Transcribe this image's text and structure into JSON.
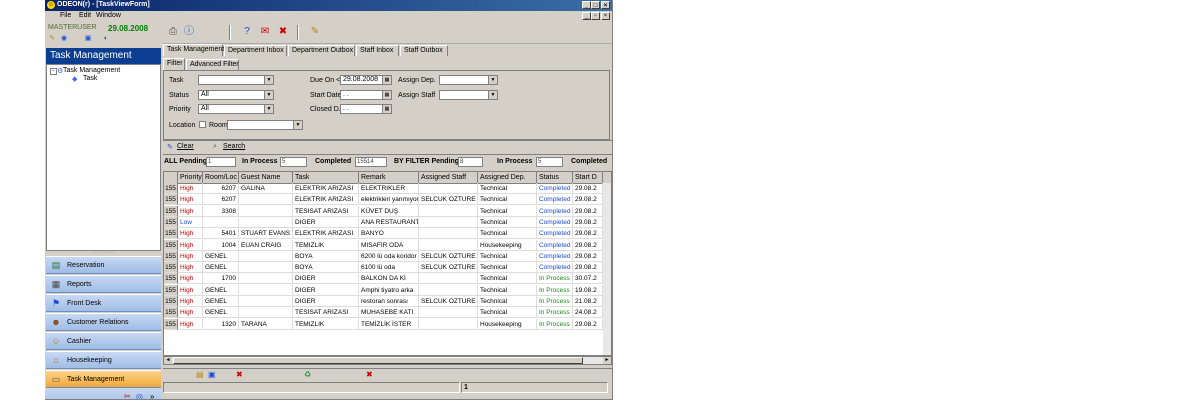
{
  "window": {
    "title": "ODEON(r) - [TaskViewForm]",
    "controls": [
      "_",
      "□",
      "×"
    ],
    "mdi_controls": [
      "_",
      "▫",
      "×"
    ]
  },
  "menu": [
    "File",
    "Edit",
    "Window"
  ],
  "user": {
    "name": "MASTERUSER",
    "date": "29.08.2008"
  },
  "left_header": "Task Management",
  "tree": {
    "root": "Task Management",
    "child": "Task"
  },
  "nav": [
    {
      "label": "Reservation",
      "icon": "reservation-icon"
    },
    {
      "label": "Reports",
      "icon": "reports-icon"
    },
    {
      "label": "Front Desk",
      "icon": "front-desk-icon"
    },
    {
      "label": "Customer Relations",
      "icon": "customer-relations-icon"
    },
    {
      "label": "Cashier",
      "icon": "cashier-icon"
    },
    {
      "label": "Housekeeping",
      "icon": "housekeeping-icon"
    },
    {
      "label": "Task Management",
      "icon": "task-management-icon"
    }
  ],
  "tabs": [
    "Task Management",
    "Department Inbox",
    "Department Outbox",
    "Staff Inbox",
    "Staff Outbox"
  ],
  "subtabs": [
    "Filter",
    "Advanced Filter"
  ],
  "filter": {
    "task_label": "Task",
    "task_value": "",
    "status_label": "Status",
    "status_value": "All",
    "priority_label": "Priority",
    "priority_value": "All",
    "location_label": "Location",
    "room_label": "Room",
    "room_value": "",
    "due_on_label": "Due On <=",
    "due_on_value": "29.08.2008",
    "start_date_label": "Start Date",
    "start_date_value": " .  .",
    "closed_label": "Closed D.",
    "closed_value": " .  .",
    "assign_dep_label": "Assign Dep.",
    "assign_dep_value": "",
    "assign_staff_label": "Assign Staff",
    "assign_staff_value": ""
  },
  "actions": {
    "clear": "Clear",
    "search": "Search"
  },
  "stats": {
    "all_pending_label": "ALL Pending",
    "all_pending": "1",
    "in_process_label": "In Process",
    "in_process": "5",
    "completed_label": "Completed",
    "completed": "15514",
    "by_filter_pending_label": "BY FILTER Pending",
    "by_filter_pending": "8",
    "bf_in_process_label": "In Process",
    "bf_in_process": "5",
    "bf_completed_label": "Completed"
  },
  "grid": {
    "columns": [
      "",
      "Priority",
      "Room/Loc",
      "Guest Name",
      "Task",
      "Remark",
      "Assigned Staff",
      "Assigned Dep.",
      "Status",
      "Start D"
    ],
    "rows": [
      [
        "155",
        "High",
        "6207",
        "GALINA",
        "ELEKTRIK ARIZASI",
        "ELEKTRIKLER",
        "",
        "Technical",
        "Completed",
        "29.08.2"
      ],
      [
        "155",
        "High",
        "6207",
        "",
        "ELEKTRIK ARIZASI",
        "elektrikleri yanmıyor",
        "SELCUK OZTURE",
        "Technical",
        "Completed",
        "29.08.2"
      ],
      [
        "155",
        "High",
        "3308",
        "",
        "TESISAT ARIZASI",
        "KÜVET DUŞ",
        "",
        "Technical",
        "Completed",
        "29.08.2"
      ],
      [
        "155",
        "Low",
        "",
        "",
        "DIGER",
        "ANA RESTAURANT",
        "",
        "Technical",
        "Completed",
        "29.08.2"
      ],
      [
        "155",
        "High",
        "5401",
        "STUART EVANS",
        "ELEKTRIK ARIZASI",
        "BANYO",
        "",
        "Technical",
        "Completed",
        "29.08.2"
      ],
      [
        "155",
        "High",
        "1004",
        "EUAN CRAIG",
        "TEMIZLIK",
        "MISAFIR ODA",
        "",
        "Housekeeping",
        "Completed",
        "29.08.2"
      ],
      [
        "155",
        "High",
        "GENEL",
        "",
        "BOYA",
        "6200 lü oda koridor",
        "SELCUK OZTURE",
        "Technical",
        "Completed",
        "29.08.2"
      ],
      [
        "155",
        "High",
        "GENEL",
        "",
        "BOYA",
        "6100 lü oda",
        "SELCUK OZTURE",
        "Technical",
        "Completed",
        "29.08.2"
      ],
      [
        "155",
        "High",
        "1700",
        "",
        "DIGER",
        "BALKON DA Kİ",
        "",
        "Technical",
        "In Process",
        "30.07.2"
      ],
      [
        "155",
        "High",
        "GENEL",
        "",
        "DIGER",
        "Amphi tiyatro  arka",
        "",
        "Technical",
        "In Process",
        "19.08.2"
      ],
      [
        "155",
        "High",
        "GENEL",
        "",
        "DIGER",
        "restoran sonrası",
        "SELCUK OZTURE",
        "Technical",
        "In Process",
        "21.08.2"
      ],
      [
        "155",
        "High",
        "GENEL",
        "",
        "TESISAT ARIZASI",
        "MUHASEBE KATI",
        "",
        "Technical",
        "In Process",
        "24.08.2"
      ],
      [
        "155",
        "High",
        "1320",
        "TARANA",
        "TEMIZLIK",
        "TEMİZLİK İSTER",
        "",
        "Housekeeping",
        "In Process",
        "29.08.2"
      ]
    ]
  },
  "statusbar": {
    "count": "1"
  },
  "colors": {
    "high": "#cc0000",
    "low": "#1a4bd6",
    "completed": "#1a4bd6",
    "in_process": "#1a8c1a",
    "nav_active": "#f3a83a",
    "header": "#0b3d91"
  }
}
